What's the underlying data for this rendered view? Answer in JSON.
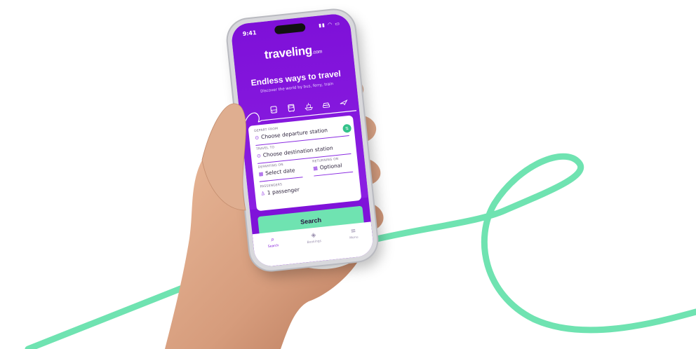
{
  "colors": {
    "brand_purple": "#7e10d8",
    "accent_mint": "#6fe3b1",
    "swap_green": "#34c28a"
  },
  "status_bar": {
    "time": "9:41",
    "icons": "signal-wifi-battery"
  },
  "app": {
    "brand_name": "traveling",
    "brand_suffix": ".com",
    "hero_title": "Endless ways to travel",
    "hero_subtitle": "Discover the world by bus, ferry, train"
  },
  "transport_icons": [
    "train-icon",
    "bus-icon",
    "ferry-icon",
    "car-icon",
    "plane-icon"
  ],
  "form": {
    "depart": {
      "label": "DEPART FROM",
      "value": "Choose departure station"
    },
    "destination": {
      "label": "TRAVEL TO",
      "value": "Choose destination station"
    },
    "departing_on": {
      "label": "DEPARTING ON",
      "value": "Select date"
    },
    "returning_on": {
      "label": "RETURNING ON",
      "value": "Optional"
    },
    "passengers": {
      "label": "PASSENGERS",
      "value": "1 passenger"
    },
    "search_label": "Search"
  },
  "bottom_nav": [
    {
      "label": "Search",
      "icon": "search-icon",
      "active": true
    },
    {
      "label": "Bookings",
      "icon": "ticket-icon",
      "active": false
    },
    {
      "label": "Menu",
      "icon": "menu-icon",
      "active": false
    }
  ]
}
